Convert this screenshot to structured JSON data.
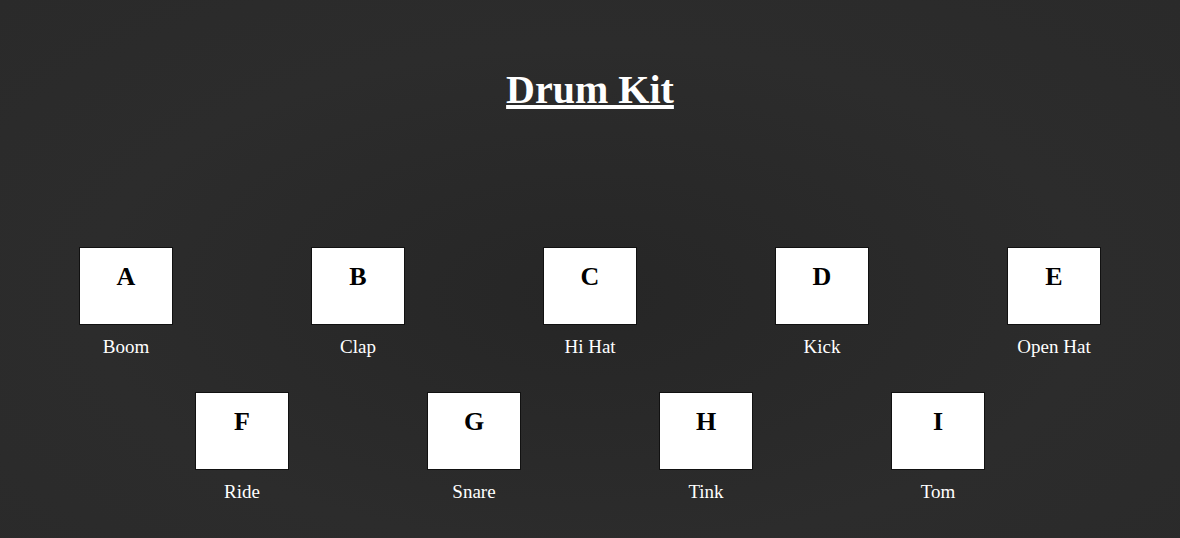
{
  "title": "Drum Kit",
  "rows": [
    {
      "keys": [
        {
          "key": "A",
          "sound": "Boom"
        },
        {
          "key": "B",
          "sound": "Clap"
        },
        {
          "key": "C",
          "sound": "Hi Hat"
        },
        {
          "key": "D",
          "sound": "Kick"
        },
        {
          "key": "E",
          "sound": "Open Hat"
        }
      ]
    },
    {
      "keys": [
        {
          "key": "F",
          "sound": "Ride"
        },
        {
          "key": "G",
          "sound": "Snare"
        },
        {
          "key": "H",
          "sound": "Tink"
        },
        {
          "key": "I",
          "sound": "Tom"
        }
      ]
    }
  ]
}
